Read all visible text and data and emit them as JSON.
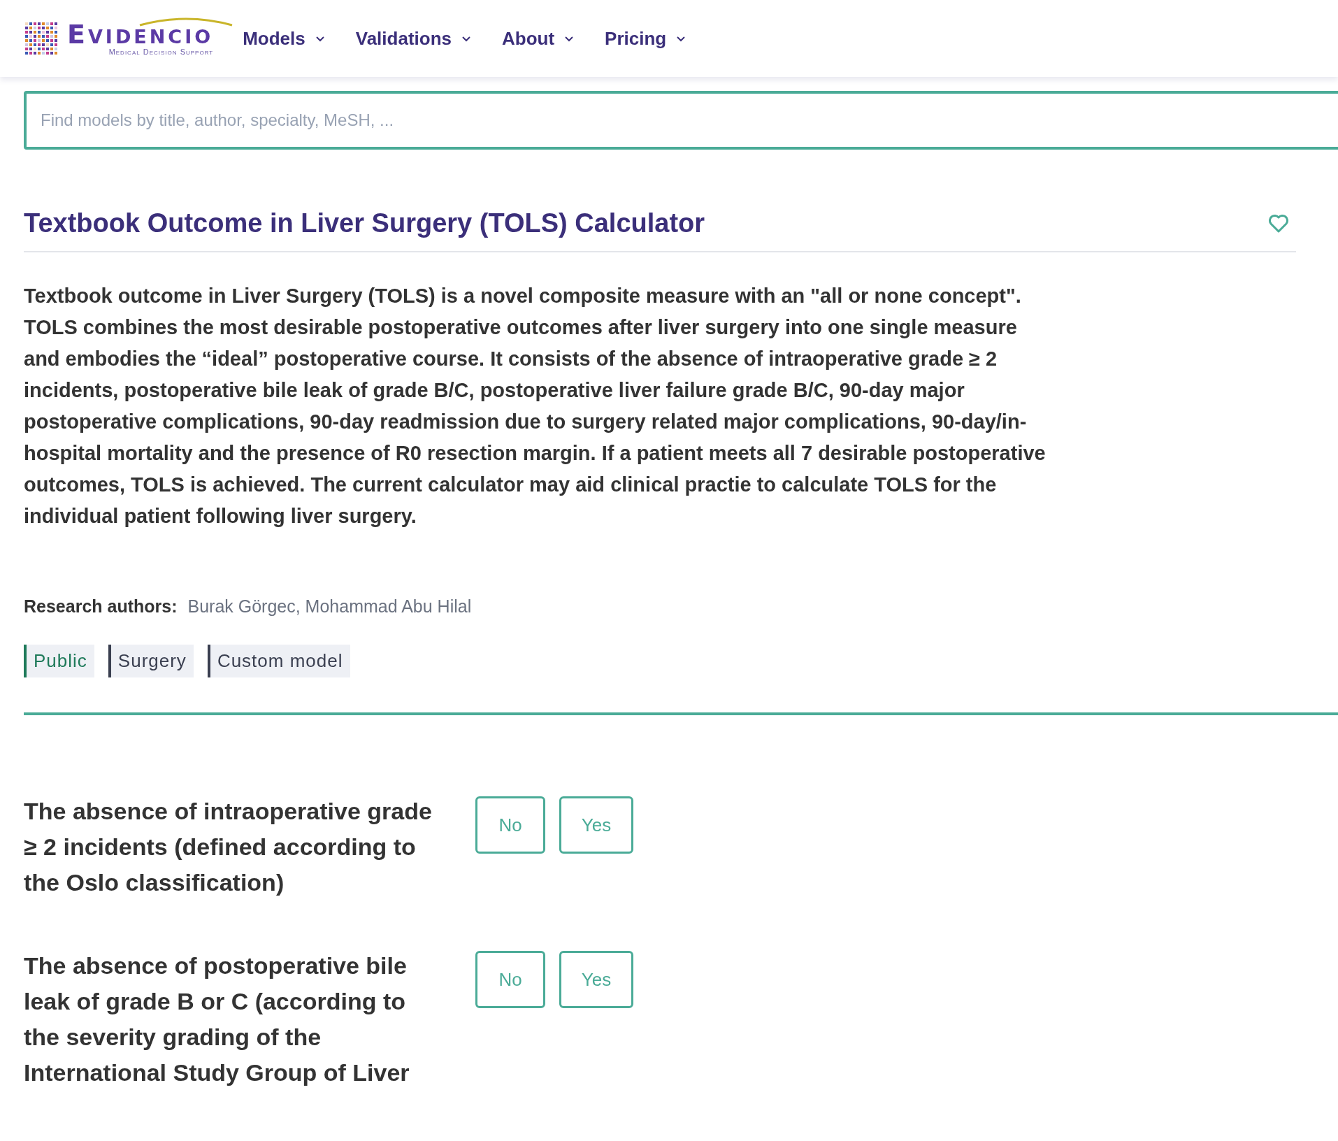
{
  "header": {
    "logo": {
      "name": "Evidencio",
      "tagline": "Medical Decision Support"
    },
    "nav": [
      {
        "label": "Models"
      },
      {
        "label": "Validations"
      },
      {
        "label": "About"
      },
      {
        "label": "Pricing"
      }
    ]
  },
  "search": {
    "placeholder": "Find models by title, author, specialty, MeSH, ..."
  },
  "model": {
    "title": "Textbook Outcome in Liver Surgery (TOLS) Calculator",
    "favorite": false,
    "description": "Textbook outcome in Liver Surgery (TOLS) is a novel composite measure with an \"all or none concept\". TOLS combines the most desirable postoperative outcomes after liver surgery into one single measure and embodies the “ideal” postoperative course. It consists of the absence of intraoperative grade ≥ 2 incidents, postoperative bile leak of grade B/C, postoperative liver failure grade B/C, 90-day major postoperative complications, 90-day readmission due to surgery related major complications, 90-day/in-hospital mortality and the presence of R0 resection margin. If a patient meets all 7 desirable postoperative outcomes, TOLS is achieved. The current calculator may aid clinical practie to calculate TOLS for the individual patient following liver surgery.",
    "authors_label": "Research authors:",
    "authors": "Burak Görgec, Mohammad Abu Hilal",
    "tags": [
      {
        "label": "Public",
        "kind": "access"
      },
      {
        "label": "Surgery",
        "kind": "category"
      },
      {
        "label": "Custom model",
        "kind": "category"
      }
    ]
  },
  "questions": [
    {
      "text": "The absence of intraoperative grade ≥ 2 incidents (defined according to the Oslo classification)",
      "options": [
        {
          "label": "No",
          "selected": false
        },
        {
          "label": "Yes",
          "selected": false
        }
      ]
    },
    {
      "text": "The absence of postoperative bile leak of grade B or C (according to the severity grading of the International Study Group of Liver",
      "options": [
        {
          "label": "No",
          "selected": false
        },
        {
          "label": "Yes",
          "selected": false
        }
      ]
    }
  ]
}
